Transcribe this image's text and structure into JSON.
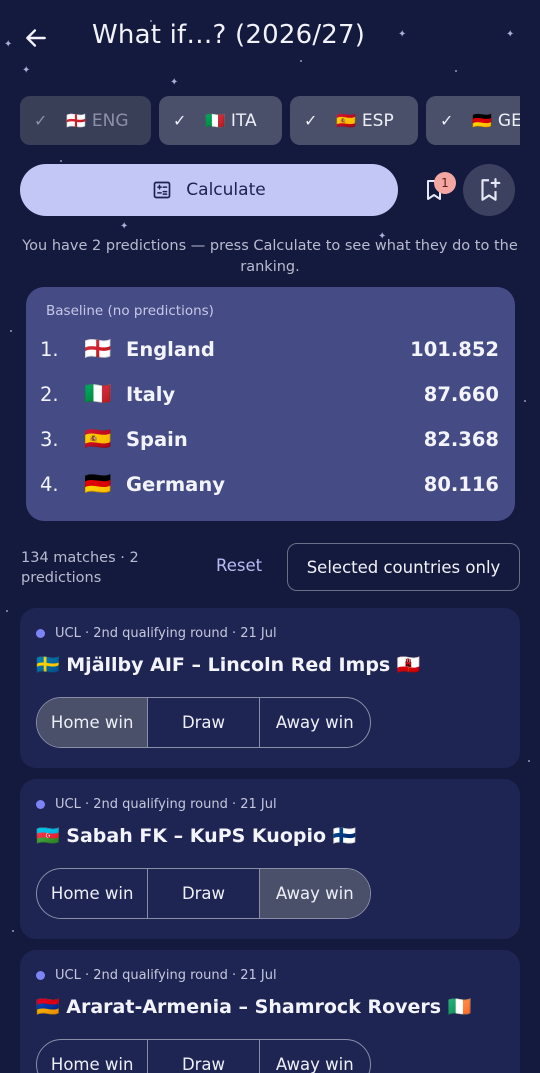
{
  "header": {
    "title": "What if…? (2026/27)"
  },
  "countries": [
    {
      "flag": "🏴󠁧󠁢󠁥󠁮󠁧󠁿",
      "code": "ENG",
      "disabled": true
    },
    {
      "flag": "🇮🇹",
      "code": "ITA",
      "disabled": false
    },
    {
      "flag": "🇪🇸",
      "code": "ESP",
      "disabled": false
    },
    {
      "flag": "🇩🇪",
      "code": "GE",
      "disabled": false
    }
  ],
  "calculate": {
    "label": "Calculate",
    "bookmark_badge": "1"
  },
  "hint": "You have 2 predictions — press Calculate to see what they do to the ranking.",
  "baseline": {
    "label": "Baseline (no predictions)",
    "rows": [
      {
        "rank": "1.",
        "flag": "🏴󠁧󠁢󠁥󠁮󠁧󠁿",
        "name": "England",
        "value": "101.852"
      },
      {
        "rank": "2.",
        "flag": "🇮🇹",
        "name": "Italy",
        "value": "87.660"
      },
      {
        "rank": "3.",
        "flag": "🇪🇸",
        "name": "Spain",
        "value": "82.368"
      },
      {
        "rank": "4.",
        "flag": "🇩🇪",
        "name": "Germany",
        "value": "80.116"
      }
    ]
  },
  "list": {
    "info": "134 matches · 2 predictions",
    "reset": "Reset",
    "filter": "Selected countries only"
  },
  "matches": [
    {
      "meta": "UCL · 2nd qualifying round · 21 Jul",
      "teams": "🇸🇪 Mjällby AIF  –  Lincoln Red Imps 🇬🇮",
      "options": [
        "Home win",
        "Draw",
        "Away win"
      ],
      "selected": 0
    },
    {
      "meta": "UCL · 2nd qualifying round · 21 Jul",
      "teams": "🇦🇿 Sabah FK  –  KuPS Kuopio 🇫🇮",
      "options": [
        "Home win",
        "Draw",
        "Away win"
      ],
      "selected": 2
    },
    {
      "meta": "UCL · 2nd qualifying round · 21 Jul",
      "teams": "🇦🇲 Ararat-Armenia  –  Shamrock Rovers 🇮🇪",
      "options": [
        "Home win",
        "Draw",
        "Away win"
      ],
      "selected": -1
    }
  ],
  "colors": {
    "background": "#141a3d",
    "accent": "#c3c7f6",
    "card": "#1e2553",
    "baseline_card": "#454b85",
    "badge": "#f4a7a2"
  }
}
